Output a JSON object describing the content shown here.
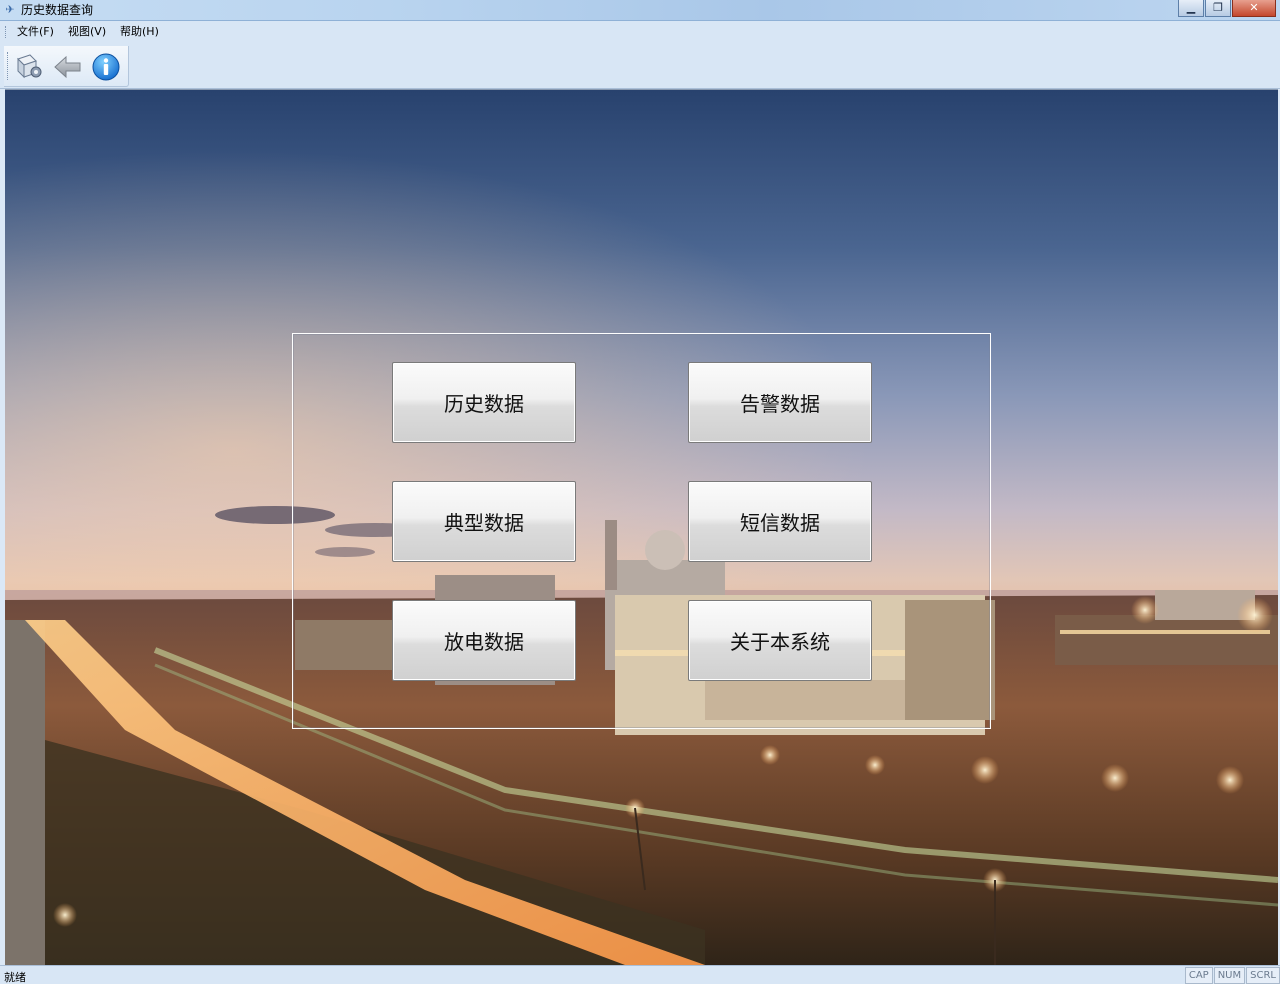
{
  "window": {
    "title": "历史数据查询",
    "controls": {
      "minimize": "▁",
      "restore": "❐",
      "close": "✕"
    }
  },
  "menu": {
    "items": [
      {
        "label": "文件(F)"
      },
      {
        "label": "视图(V)"
      },
      {
        "label": "帮助(H)"
      }
    ]
  },
  "toolbar": {
    "buttons": [
      {
        "icon": "document-gear-icon"
      },
      {
        "icon": "back-arrow-icon"
      },
      {
        "icon": "info-icon"
      }
    ]
  },
  "panel": {
    "buttons": [
      {
        "label": "历史数据"
      },
      {
        "label": "告警数据"
      },
      {
        "label": "典型数据"
      },
      {
        "label": "短信数据"
      },
      {
        "label": "放电数据"
      },
      {
        "label": "关于本系统"
      }
    ]
  },
  "background": {
    "description_icon": "power-plant-dusk-photo"
  },
  "statusbar": {
    "text": "就绪",
    "indicators": [
      "CAP",
      "NUM",
      "SCRL"
    ]
  },
  "colors": {
    "chrome": "#d8e6f5",
    "title_gradient_end": "#a9c7e8",
    "close_button": "#c4472c"
  }
}
